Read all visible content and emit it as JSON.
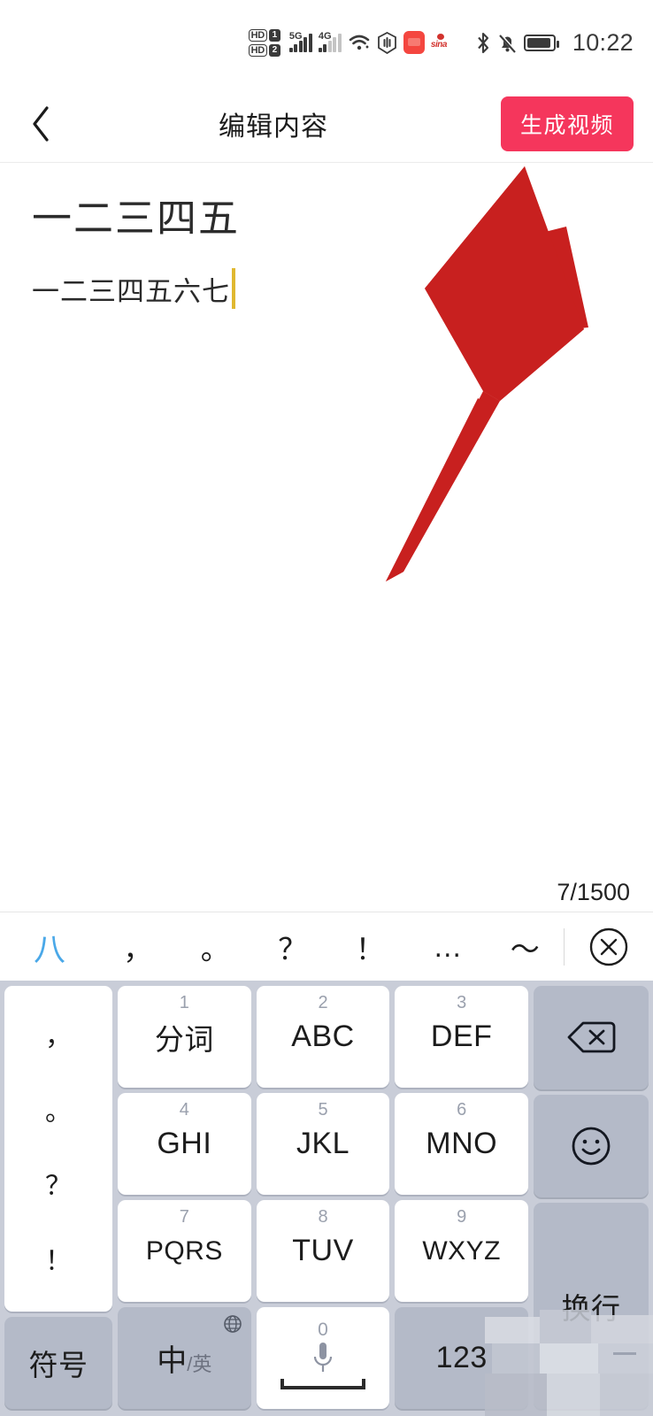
{
  "status_bar": {
    "hd_labels": [
      "HD",
      "HD"
    ],
    "sim_labels": [
      "1",
      "2"
    ],
    "network_1": "5G",
    "network_2": "4G",
    "icons": [
      "hd1-icon",
      "hd2-icon",
      "signal-5g-icon",
      "signal-4g-icon",
      "wifi-icon",
      "do-not-disturb-icon",
      "huawei-app-icon",
      "sina-weibo-icon",
      "bluetooth-icon",
      "mute-bell-icon",
      "battery-icon"
    ],
    "sina_label": "sina",
    "time": "10:22"
  },
  "nav": {
    "back_icon": "chevron-left-icon",
    "title": "编辑内容",
    "action_label": "生成视频",
    "action_color": "#f5365c"
  },
  "editor": {
    "title_text": "一二三四五",
    "body_text": "一二三四五六七",
    "caret_color": "#e0b830",
    "counter": "7/1500",
    "max_chars": 1500,
    "current_chars": 7
  },
  "annotation": {
    "arrow_color": "#c8201f",
    "arrow_name": "red-pointer-arrow",
    "points_to": "生成视频"
  },
  "keyboard": {
    "candidate_word": "八",
    "candidate_color": "#4aa8e8",
    "punctuation": [
      "，",
      "。",
      "？",
      "！",
      "…",
      "～"
    ],
    "close_icon": "close-circle-icon",
    "punct_column": [
      "，",
      "。",
      "？",
      "！"
    ],
    "rows": [
      [
        {
          "num": "1",
          "label": "分词",
          "style": "cn"
        },
        {
          "num": "2",
          "label": "ABC",
          "style": "en"
        },
        {
          "num": "3",
          "label": "DEF",
          "style": "en"
        }
      ],
      [
        {
          "num": "4",
          "label": "GHI",
          "style": "en"
        },
        {
          "num": "5",
          "label": "JKL",
          "style": "en"
        },
        {
          "num": "6",
          "label": "MNO",
          "style": "en"
        }
      ],
      [
        {
          "num": "7",
          "label": "PQRS",
          "style": "en"
        },
        {
          "num": "8",
          "label": "TUV",
          "style": "en"
        },
        {
          "num": "9",
          "label": "WXYZ",
          "style": "en"
        }
      ]
    ],
    "bottom_row": {
      "symbol_label": "符号",
      "lang_big": "中",
      "lang_small": "英",
      "globe_icon": "globe-icon",
      "space_zero": "0",
      "mic_icon": "microphone-icon",
      "numeric_label": "123"
    },
    "right_column": {
      "backspace_icon": "backspace-icon",
      "emoji_icon": "emoji-smiley-icon",
      "enter_label": "换行"
    },
    "bg_color": "#c9cdd8",
    "key_color": "#ffffff",
    "dark_key_color": "#b4bac8"
  }
}
